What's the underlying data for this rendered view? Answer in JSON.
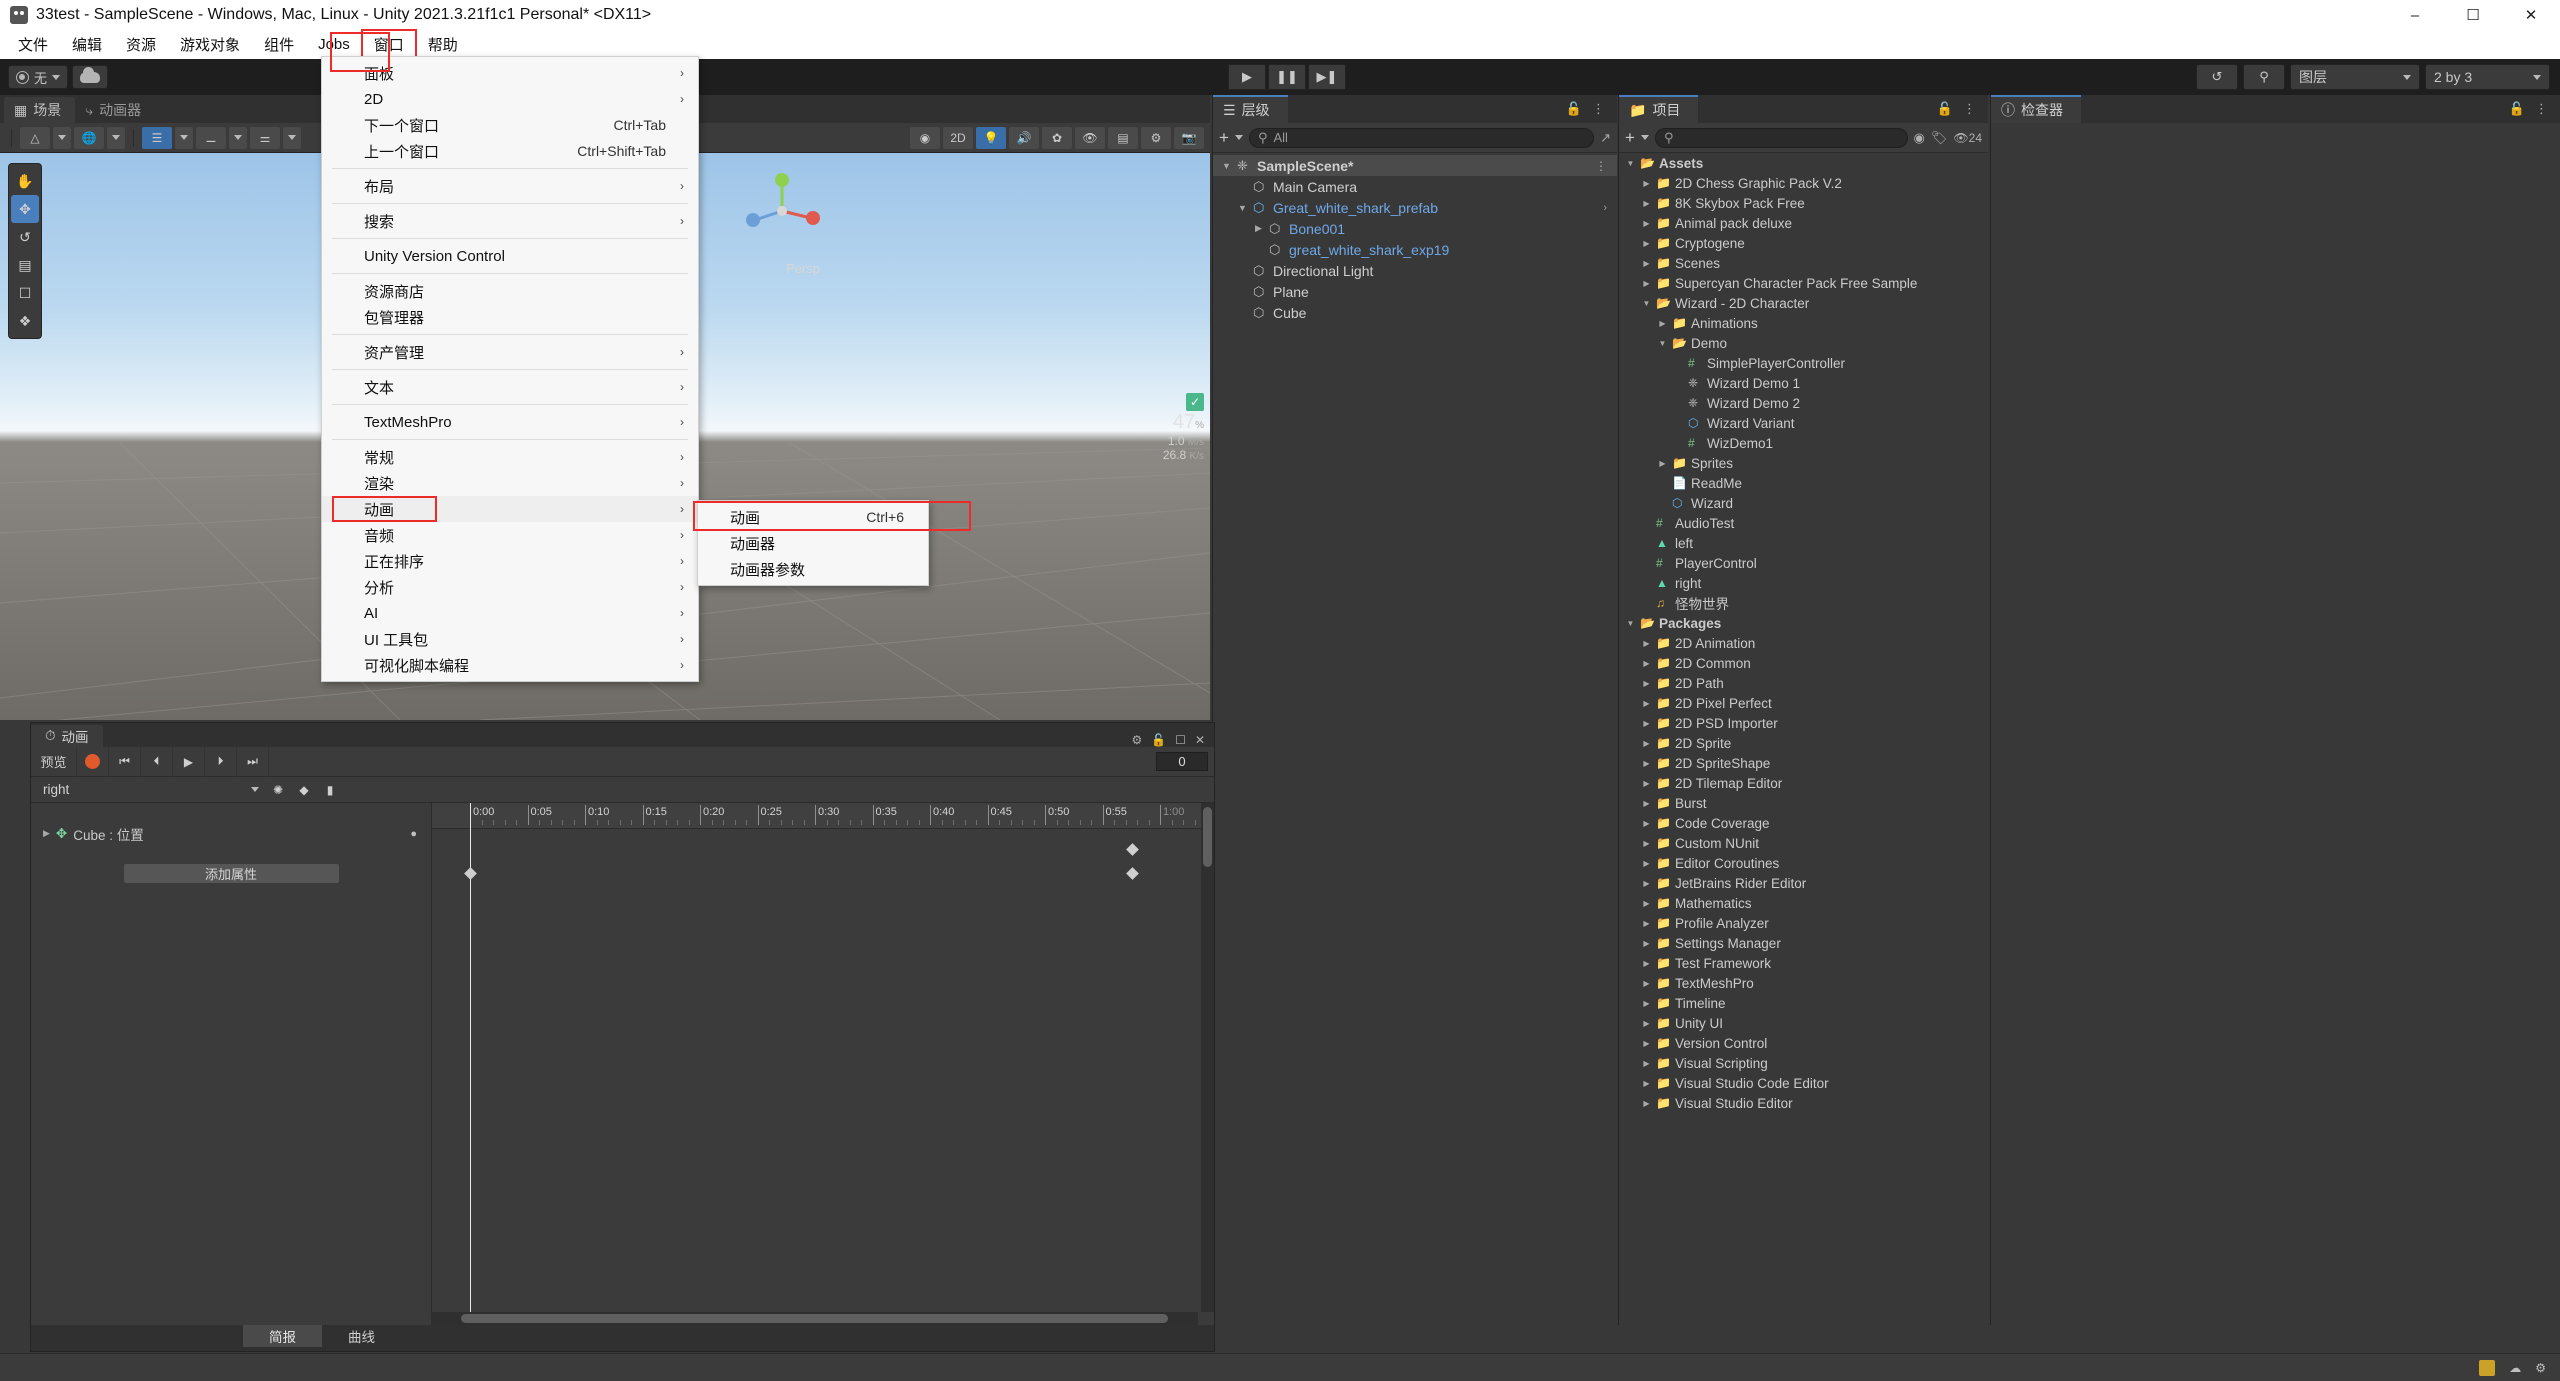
{
  "window": {
    "title": "33test - SampleScene - Windows, Mac, Linux - Unity 2021.3.21f1c1 Personal* <DX11>",
    "minimize": "–",
    "maximize": "☐",
    "close": "✕"
  },
  "menubar": {
    "items": [
      {
        "label": "文件",
        "name": "menu-file"
      },
      {
        "label": "编辑",
        "name": "menu-edit"
      },
      {
        "label": "资源",
        "name": "menu-assets"
      },
      {
        "label": "游戏对象",
        "name": "menu-gameobject"
      },
      {
        "label": "组件",
        "name": "menu-component"
      },
      {
        "label": "Jobs",
        "name": "menu-jobs"
      },
      {
        "label": "窗口",
        "name": "menu-window",
        "highlighted": true
      },
      {
        "label": "帮助",
        "name": "menu-help"
      }
    ]
  },
  "window_menu": {
    "items": [
      {
        "label": "面板",
        "arrow": true,
        "shortcut": ""
      },
      {
        "label": "2D",
        "arrow": true,
        "shortcut": ""
      },
      {
        "label": "下一个窗口",
        "arrow": false,
        "shortcut": "Ctrl+Tab"
      },
      {
        "label": "上一个窗口",
        "arrow": false,
        "shortcut": "Ctrl+Shift+Tab"
      },
      {
        "divider": true
      },
      {
        "label": "布局",
        "arrow": true,
        "shortcut": ""
      },
      {
        "divider": true
      },
      {
        "label": "搜索",
        "arrow": true,
        "shortcut": ""
      },
      {
        "divider": true
      },
      {
        "label": "Unity Version Control",
        "arrow": false,
        "shortcut": ""
      },
      {
        "divider": true
      },
      {
        "label": "资源商店",
        "arrow": false,
        "shortcut": ""
      },
      {
        "label": "包管理器",
        "arrow": false,
        "shortcut": ""
      },
      {
        "divider": true
      },
      {
        "label": "资产管理",
        "arrow": true,
        "shortcut": ""
      },
      {
        "divider": true
      },
      {
        "label": "文本",
        "arrow": true,
        "shortcut": ""
      },
      {
        "divider": true
      },
      {
        "label": "TextMeshPro",
        "arrow": true,
        "shortcut": ""
      },
      {
        "divider": true
      },
      {
        "label": "常规",
        "arrow": true,
        "shortcut": ""
      },
      {
        "label": "渲染",
        "arrow": true,
        "shortcut": ""
      },
      {
        "label": "动画",
        "arrow": true,
        "shortcut": "",
        "highlighted": true,
        "boxed": true
      },
      {
        "label": "音频",
        "arrow": true,
        "shortcut": ""
      },
      {
        "label": "正在排序",
        "arrow": true,
        "shortcut": ""
      },
      {
        "label": "分析",
        "arrow": true,
        "shortcut": ""
      },
      {
        "label": "AI",
        "arrow": true,
        "shortcut": ""
      },
      {
        "label": "UI 工具包",
        "arrow": true,
        "shortcut": ""
      },
      {
        "label": "可视化脚本编程",
        "arrow": true,
        "shortcut": ""
      }
    ]
  },
  "animation_submenu": {
    "items": [
      {
        "label": "动画",
        "shortcut": "Ctrl+6",
        "boxed": true
      },
      {
        "label": "动画器",
        "shortcut": ""
      },
      {
        "label": "动画器参数",
        "shortcut": ""
      }
    ]
  },
  "toolbar": {
    "account_label": "无",
    "cloud_icon": "cloud-icon",
    "play": "▶",
    "pause": "❚❚",
    "step": "▶❚",
    "history_icon": "history-icon",
    "search_icon": "search-icon",
    "layers_label": "图层",
    "layout_label": "2 by 3"
  },
  "scene_panel": {
    "tabs": [
      {
        "label": "场景",
        "icon": "grid-icon",
        "active": true
      },
      {
        "label": "动画器",
        "icon": "animator-icon",
        "active": false
      }
    ],
    "gizmo_axes": [
      "x",
      "y",
      "z"
    ],
    "persp_label": "Persp",
    "stats": {
      "fps": "47",
      "fps_unit": "%",
      "mem": "1.0",
      "mem_unit": "M/s",
      "net": "26.8",
      "net_unit": "K/s"
    }
  },
  "hierarchy": {
    "tab_label": "层级",
    "search_placeholder": "All",
    "items": [
      {
        "label": "SampleScene*",
        "depth": 0,
        "icon": "unity-scene-icon",
        "arrow": "▼",
        "bold": true,
        "selected": true
      },
      {
        "label": "Main Camera",
        "depth": 1,
        "icon": "gameobject-icon",
        "arrow": ""
      },
      {
        "label": "Great_white_shark_prefab",
        "depth": 1,
        "icon": "prefab-icon",
        "arrow": "▼",
        "blue": true
      },
      {
        "label": "Bone001",
        "depth": 2,
        "icon": "gameobject-icon",
        "arrow": "▶",
        "blue": true
      },
      {
        "label": "great_white_shark_exp19",
        "depth": 2,
        "icon": "gameobject-icon",
        "arrow": "",
        "blue": true
      },
      {
        "label": "Directional Light",
        "depth": 1,
        "icon": "gameobject-icon",
        "arrow": ""
      },
      {
        "label": "Plane",
        "depth": 1,
        "icon": "gameobject-icon",
        "arrow": ""
      },
      {
        "label": "Cube",
        "depth": 1,
        "icon": "gameobject-icon",
        "arrow": ""
      }
    ]
  },
  "project": {
    "tab_label": "项目",
    "search_placeholder": "",
    "hidden_count": "24",
    "items": [
      {
        "label": "Assets",
        "depth": 0,
        "icon": "folder-open-icon",
        "arrow": "▼",
        "bold": true
      },
      {
        "label": "2D Chess Graphic Pack V.2",
        "depth": 1,
        "icon": "folder-icon",
        "arrow": "▶"
      },
      {
        "label": "8K Skybox Pack Free",
        "depth": 1,
        "icon": "folder-icon",
        "arrow": "▶"
      },
      {
        "label": "Animal pack deluxe",
        "depth": 1,
        "icon": "folder-icon",
        "arrow": "▶"
      },
      {
        "label": "Cryptogene",
        "depth": 1,
        "icon": "folder-icon",
        "arrow": "▶"
      },
      {
        "label": "Scenes",
        "depth": 1,
        "icon": "folder-icon",
        "arrow": "▶"
      },
      {
        "label": "Supercyan Character Pack Free Sample",
        "depth": 1,
        "icon": "folder-icon",
        "arrow": "▶"
      },
      {
        "label": "Wizard - 2D Character",
        "depth": 1,
        "icon": "folder-open-icon",
        "arrow": "▼"
      },
      {
        "label": "Animations",
        "depth": 2,
        "icon": "folder-icon",
        "arrow": "▶"
      },
      {
        "label": "Demo",
        "depth": 2,
        "icon": "folder-open-icon",
        "arrow": "▼"
      },
      {
        "label": "SimplePlayerController",
        "depth": 3,
        "icon": "script-icon",
        "arrow": ""
      },
      {
        "label": "Wizard Demo 1",
        "depth": 3,
        "icon": "unity-scene-icon",
        "arrow": ""
      },
      {
        "label": "Wizard Demo 2",
        "depth": 3,
        "icon": "unity-scene-icon",
        "arrow": ""
      },
      {
        "label": "Wizard Variant",
        "depth": 3,
        "icon": "prefab-variant-icon",
        "arrow": ""
      },
      {
        "label": "WizDemo1",
        "depth": 3,
        "icon": "script-icon",
        "arrow": ""
      },
      {
        "label": "Sprites",
        "depth": 2,
        "icon": "folder-icon",
        "arrow": "▶"
      },
      {
        "label": "ReadMe",
        "depth": 2,
        "icon": "pdf-icon",
        "arrow": ""
      },
      {
        "label": "Wizard",
        "depth": 2,
        "icon": "prefab-icon",
        "arrow": ""
      },
      {
        "label": "AudioTest",
        "depth": 1,
        "icon": "script-icon",
        "arrow": ""
      },
      {
        "label": "left",
        "depth": 1,
        "icon": "anim-clip-icon",
        "arrow": ""
      },
      {
        "label": "PlayerControl",
        "depth": 1,
        "icon": "script-icon",
        "arrow": ""
      },
      {
        "label": "right",
        "depth": 1,
        "icon": "anim-clip-icon",
        "arrow": ""
      },
      {
        "label": "怪物世界",
        "depth": 1,
        "icon": "audio-icon",
        "arrow": ""
      },
      {
        "label": "Packages",
        "depth": 0,
        "icon": "folder-open-icon",
        "arrow": "▼",
        "bold": true
      },
      {
        "label": "2D Animation",
        "depth": 1,
        "icon": "folder-icon",
        "arrow": "▶"
      },
      {
        "label": "2D Common",
        "depth": 1,
        "icon": "folder-icon",
        "arrow": "▶"
      },
      {
        "label": "2D Path",
        "depth": 1,
        "icon": "folder-icon",
        "arrow": "▶"
      },
      {
        "label": "2D Pixel Perfect",
        "depth": 1,
        "icon": "folder-icon",
        "arrow": "▶"
      },
      {
        "label": "2D PSD Importer",
        "depth": 1,
        "icon": "folder-icon",
        "arrow": "▶"
      },
      {
        "label": "2D Sprite",
        "depth": 1,
        "icon": "folder-icon",
        "arrow": "▶"
      },
      {
        "label": "2D SpriteShape",
        "depth": 1,
        "icon": "folder-icon",
        "arrow": "▶"
      },
      {
        "label": "2D Tilemap Editor",
        "depth": 1,
        "icon": "folder-icon",
        "arrow": "▶"
      },
      {
        "label": "Burst",
        "depth": 1,
        "icon": "folder-icon",
        "arrow": "▶"
      },
      {
        "label": "Code Coverage",
        "depth": 1,
        "icon": "folder-icon",
        "arrow": "▶"
      },
      {
        "label": "Custom NUnit",
        "depth": 1,
        "icon": "folder-icon",
        "arrow": "▶"
      },
      {
        "label": "Editor Coroutines",
        "depth": 1,
        "icon": "folder-icon",
        "arrow": "▶"
      },
      {
        "label": "JetBrains Rider Editor",
        "depth": 1,
        "icon": "folder-icon",
        "arrow": "▶"
      },
      {
        "label": "Mathematics",
        "depth": 1,
        "icon": "folder-icon",
        "arrow": "▶"
      },
      {
        "label": "Profile Analyzer",
        "depth": 1,
        "icon": "folder-icon",
        "arrow": "▶"
      },
      {
        "label": "Settings Manager",
        "depth": 1,
        "icon": "folder-icon",
        "arrow": "▶"
      },
      {
        "label": "Test Framework",
        "depth": 1,
        "icon": "folder-icon",
        "arrow": "▶"
      },
      {
        "label": "TextMeshPro",
        "depth": 1,
        "icon": "folder-icon",
        "arrow": "▶"
      },
      {
        "label": "Timeline",
        "depth": 1,
        "icon": "folder-icon",
        "arrow": "▶"
      },
      {
        "label": "Unity UI",
        "depth": 1,
        "icon": "folder-icon",
        "arrow": "▶"
      },
      {
        "label": "Version Control",
        "depth": 1,
        "icon": "folder-icon",
        "arrow": "▶"
      },
      {
        "label": "Visual Scripting",
        "depth": 1,
        "icon": "folder-icon",
        "arrow": "▶"
      },
      {
        "label": "Visual Studio Code Editor",
        "depth": 1,
        "icon": "folder-icon",
        "arrow": "▶"
      },
      {
        "label": "Visual Studio Editor",
        "depth": 1,
        "icon": "folder-icon",
        "arrow": "▶"
      }
    ]
  },
  "inspector": {
    "tab_label": "检查器"
  },
  "animation_window": {
    "tab_label": "动画",
    "preview_label": "预览",
    "record_icon": "record-icon",
    "first_frame": "⏮",
    "prev_frame": "⏴",
    "play": "▶",
    "next_frame": "⏵",
    "last_frame": "⏭",
    "frame_value": "0",
    "clip_name": "right",
    "add_keyframe_icon": "add-keyframe-icon",
    "add_event_icon": "add-event-icon",
    "filter_icon": "filter-icon",
    "property_row": "Cube : 位置",
    "add_property_label": "添加属性",
    "ruler_ticks": [
      "0:00",
      "0:05",
      "0:10",
      "0:15",
      "0:20",
      "0:25",
      "0:30",
      "0:35",
      "0:40",
      "0:45",
      "0:50",
      "0:55",
      "1:00"
    ],
    "bottom_tabs": [
      {
        "label": "简报",
        "active": true
      },
      {
        "label": "曲线",
        "active": false
      }
    ]
  },
  "colors": {
    "accent": "#4a7fbd",
    "highlight_red": "#ee2b2b",
    "panel_bg": "#383838",
    "toolbar_bg": "#3b3b3b",
    "record_red": "#e05a2b",
    "link_blue": "#6fa8e8"
  }
}
